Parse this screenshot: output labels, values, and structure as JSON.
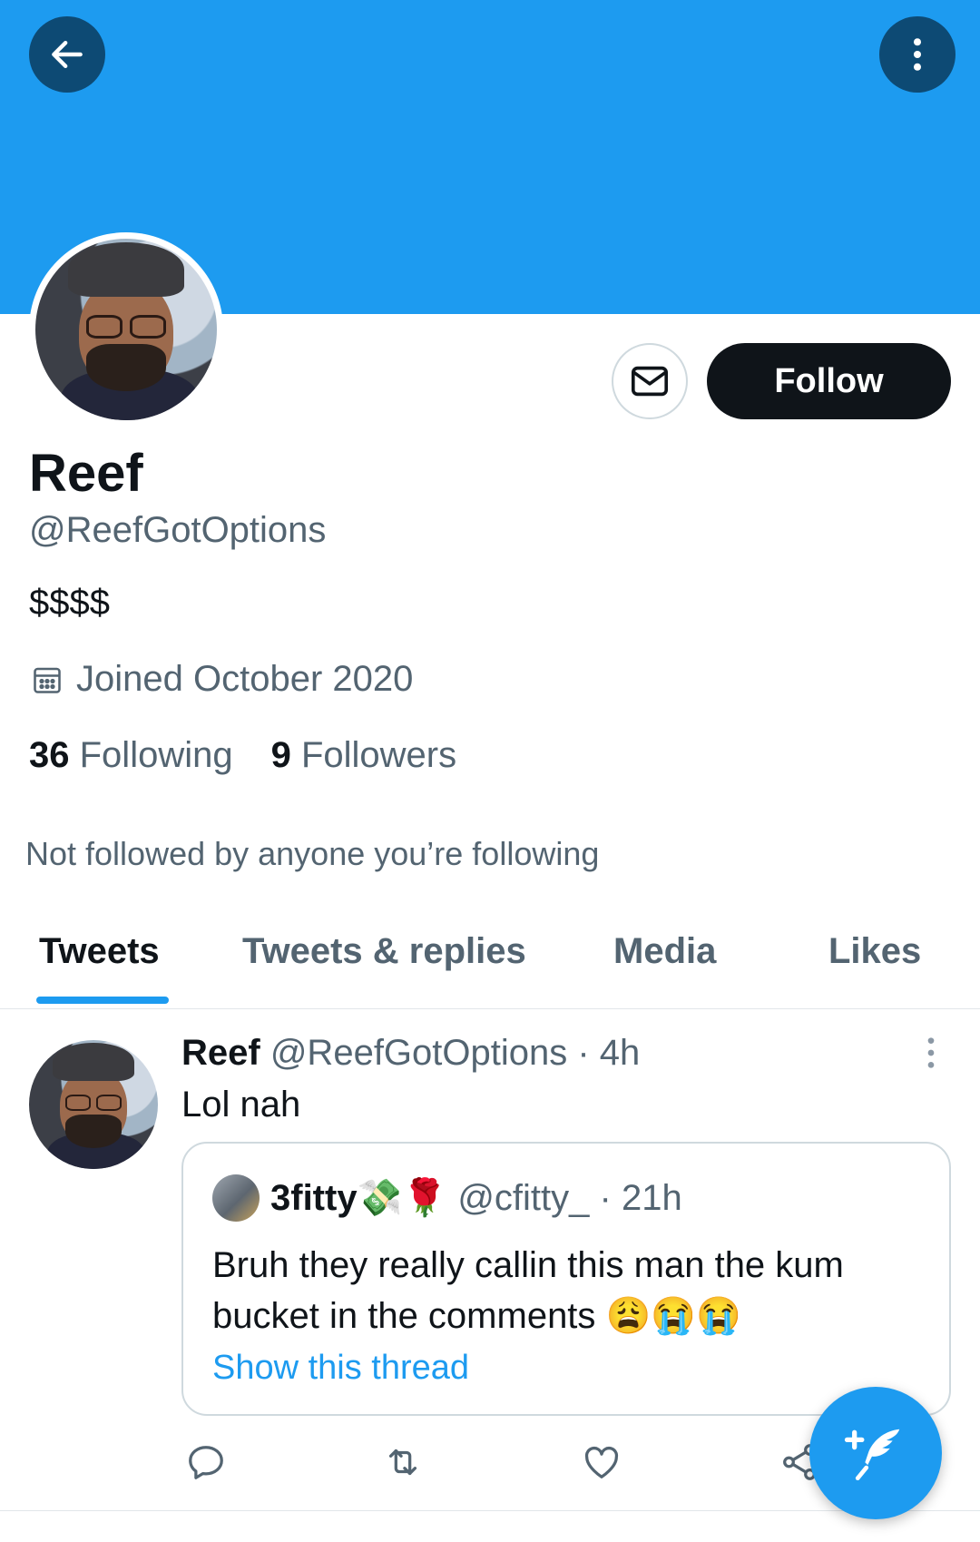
{
  "header": {
    "back_icon": "arrow-left-icon",
    "more_icon": "more-vertical-icon",
    "banner_color": "#1d9bf0"
  },
  "profile": {
    "name": "Reef",
    "handle": "@ReefGotOptions",
    "bio": "$$$$",
    "joined": "Joined October 2020",
    "following_count": "36",
    "following_label": "Following",
    "followers_count": "9",
    "followers_label": "Followers",
    "not_followed": "Not followed by anyone you’re following",
    "follow_label": "Follow"
  },
  "tabs": [
    {
      "label": "Tweets",
      "active": true
    },
    {
      "label": "Tweets & replies",
      "active": false
    },
    {
      "label": "Media",
      "active": false
    },
    {
      "label": "Likes",
      "active": false
    }
  ],
  "tweet": {
    "name": "Reef",
    "handle": "@ReefGotOptions",
    "time": "· 4h",
    "text": "Lol nah",
    "quote": {
      "name": "3fitty💸🌹",
      "handle": "@cfitty_",
      "time": "· 21h",
      "text": "Bruh they really callin this man the kum bucket in the comments 😩😭😭",
      "link": "Show this thread"
    }
  },
  "colors": {
    "accent": "#1d9bf0",
    "text": "#0f1419",
    "secondary": "#536471"
  }
}
